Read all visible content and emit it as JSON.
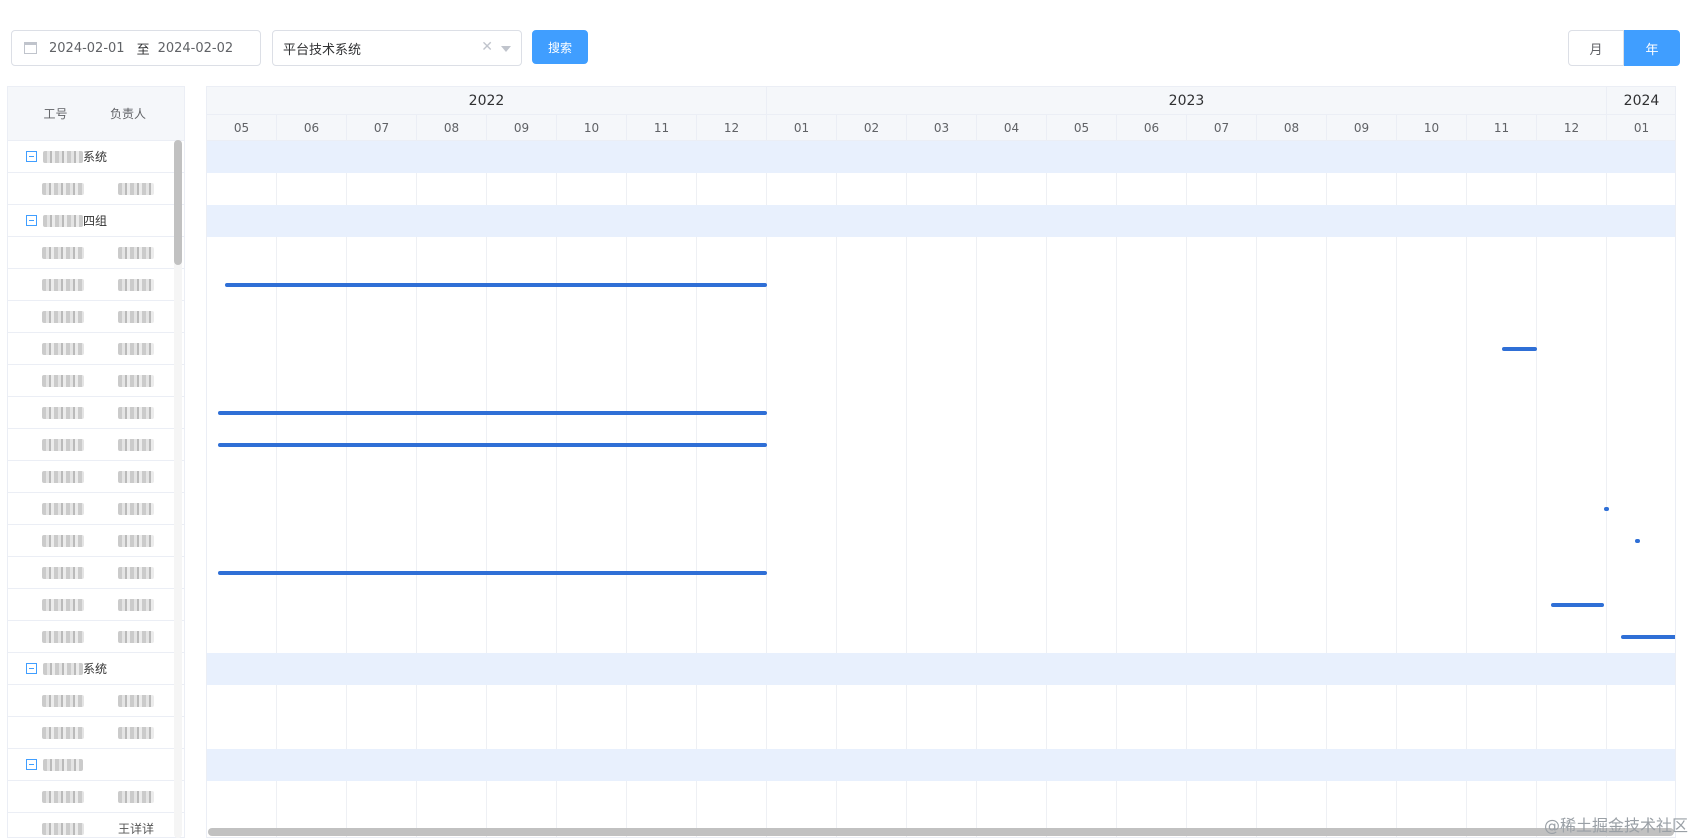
{
  "toolbar": {
    "date_start": "2024-02-01",
    "date_separator": "至",
    "date_end": "2024-02-02",
    "select_value": "平台技术系统",
    "search_label": "搜索",
    "mode_month": "月",
    "mode_year": "年",
    "active_mode": "年"
  },
  "left_table": {
    "col_id": "工号",
    "col_owner": "负责人",
    "rows": [
      {
        "type": "group",
        "label": "系统"
      },
      {
        "type": "person",
        "c1": "",
        "c2": ""
      },
      {
        "type": "group",
        "label": "四组"
      },
      {
        "type": "person",
        "c1": "",
        "c2": ""
      },
      {
        "type": "person",
        "c1": "",
        "c2": ""
      },
      {
        "type": "person",
        "c1": "",
        "c2": ""
      },
      {
        "type": "person",
        "c1": "",
        "c2": ""
      },
      {
        "type": "person",
        "c1": "",
        "c2": ""
      },
      {
        "type": "person",
        "c1": "",
        "c2": ""
      },
      {
        "type": "person",
        "c1": "",
        "c2": ""
      },
      {
        "type": "person",
        "c1": "",
        "c2": ""
      },
      {
        "type": "person",
        "c1": "",
        "c2": ""
      },
      {
        "type": "person",
        "c1": "",
        "c2": ""
      },
      {
        "type": "person",
        "c1": "",
        "c2": ""
      },
      {
        "type": "person",
        "c1": "",
        "c2": ""
      },
      {
        "type": "person",
        "c1": "",
        "c2": ""
      },
      {
        "type": "group",
        "label": "系统"
      },
      {
        "type": "person",
        "c1": "",
        "c2": ""
      },
      {
        "type": "person",
        "c1": "",
        "c2": ""
      },
      {
        "type": "group",
        "label": ""
      },
      {
        "type": "person",
        "c1": "",
        "c2": ""
      },
      {
        "type": "person",
        "c1": "",
        "c2": "王详详"
      }
    ]
  },
  "gantt": {
    "years": [
      {
        "label": "2022",
        "months": 8
      },
      {
        "label": "2023",
        "months": 12
      },
      {
        "label": "2024",
        "months": 1
      }
    ],
    "months": [
      "05",
      "06",
      "07",
      "08",
      "09",
      "10",
      "11",
      "12",
      "01",
      "02",
      "03",
      "04",
      "05",
      "06",
      "07",
      "08",
      "09",
      "10",
      "11",
      "12",
      "01"
    ],
    "tasks": [
      {
        "row": 4,
        "start": 0.25,
        "end": 8.0
      },
      {
        "row": 6,
        "start": 18.5,
        "end": 19.0
      },
      {
        "row": 8,
        "start": 0.15,
        "end": 8.0
      },
      {
        "row": 9,
        "start": 0.15,
        "end": 8.0
      },
      {
        "row": 11,
        "start": 19.95,
        "end": 20.0
      },
      {
        "row": 12,
        "start": 20.4,
        "end": 20.45
      },
      {
        "row": 13,
        "start": 0.15,
        "end": 8.0
      },
      {
        "row": 14,
        "start": 19.2,
        "end": 19.95
      },
      {
        "row": 15,
        "start": 20.2,
        "end": 21.0
      }
    ]
  },
  "watermark": "@稀土掘金技术社区"
}
